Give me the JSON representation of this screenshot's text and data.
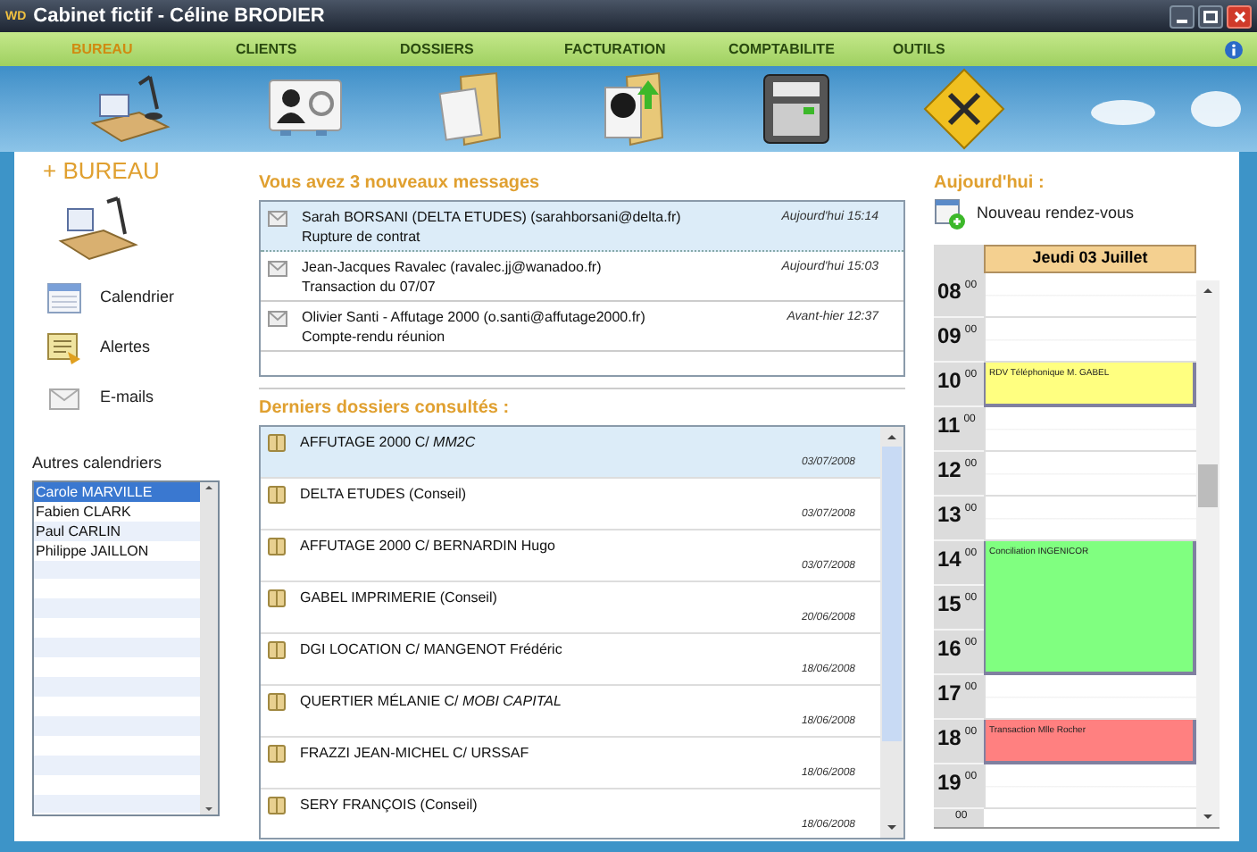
{
  "window": {
    "logo": "WD",
    "title": "Cabinet fictif - Céline BRODIER"
  },
  "menu": [
    {
      "label": "BUREAU",
      "selected": true
    },
    {
      "label": "CLIENTS",
      "selected": false
    },
    {
      "label": "DOSSIERS",
      "selected": false
    },
    {
      "label": "FACTURATION",
      "selected": false
    },
    {
      "label": "COMPTABILITE",
      "selected": false
    },
    {
      "label": "OUTILS",
      "selected": false
    }
  ],
  "sidebar": {
    "title": "+ BUREAU",
    "items": [
      {
        "label": "Calendrier"
      },
      {
        "label": "Alertes"
      },
      {
        "label": "E-mails"
      }
    ],
    "calendars_label": "Autres calendriers",
    "calendars": [
      {
        "name": "Carole MARVILLE",
        "selected": true
      },
      {
        "name": "Fabien CLARK",
        "selected": false
      },
      {
        "name": "Paul CARLIN",
        "selected": false
      },
      {
        "name": "Philippe JAILLON",
        "selected": false
      }
    ]
  },
  "messages": {
    "title": "Vous avez 3 nouveaux messages",
    "items": [
      {
        "sender": "Sarah BORSANI (DELTA ETUDES) (sarahborsani@delta.fr)",
        "subject": "Rupture de contrat",
        "time": "Aujourd'hui 15:14",
        "selected": true
      },
      {
        "sender": "Jean-Jacques Ravalec (ravalec.jj@wanadoo.fr)",
        "subject": "Transaction du 07/07",
        "time": "Aujourd'hui 15:03",
        "selected": false
      },
      {
        "sender": "Olivier Santi - Affutage 2000 (o.santi@affutage2000.fr)",
        "subject": "Compte-rendu réunion",
        "time": "Avant-hier 12:37",
        "selected": false
      }
    ]
  },
  "files": {
    "title": "Derniers dossiers consultés :",
    "items": [
      {
        "name": "AFFUTAGE 2000 C/ *MM2C*",
        "date": "03/07/2008",
        "selected": true
      },
      {
        "name": "DELTA ETUDES (Conseil)",
        "date": "03/07/2008",
        "selected": false
      },
      {
        "name": "AFFUTAGE 2000 C/ BERNARDIN Hugo",
        "date": "03/07/2008",
        "selected": false
      },
      {
        "name": "GABEL IMPRIMERIE (Conseil)",
        "date": "20/06/2008",
        "selected": false
      },
      {
        "name": "DGI LOCATION C/ MANGENOT Frédéric",
        "date": "18/06/2008",
        "selected": false
      },
      {
        "name": "QUERTIER MÉLANIE C/ *MOBI CAPITAL*",
        "date": "18/06/2008",
        "selected": false
      },
      {
        "name": "FRAZZI JEAN-MICHEL C/ URSSAF",
        "date": "18/06/2008",
        "selected": false
      },
      {
        "name": "SERY FRANÇOIS (Conseil)",
        "date": "18/06/2008",
        "selected": false
      }
    ]
  },
  "today": {
    "title": "Aujourd'hui :",
    "new_appointment": "Nouveau rendez-vous",
    "day": "Jeudi 03 Juillet",
    "hours": [
      {
        "hour": "08",
        "minutes": "00"
      },
      {
        "hour": "09",
        "minutes": "00"
      },
      {
        "hour": "10",
        "minutes": "00",
        "event": {
          "label": "RDV Téléphonique M. GABEL",
          "color": "#ffff80"
        }
      },
      {
        "hour": "11",
        "minutes": "00"
      },
      {
        "hour": "12",
        "minutes": "00"
      },
      {
        "hour": "13",
        "minutes": "00"
      },
      {
        "hour": "14",
        "minutes": "00",
        "event": {
          "label": "Conciliation INGENICOR",
          "color": "#80ff80"
        }
      },
      {
        "hour": "15",
        "minutes": "00",
        "continues": true
      },
      {
        "hour": "16",
        "minutes": "00",
        "continues": true
      },
      {
        "hour": "17",
        "minutes": "00"
      },
      {
        "hour": "18",
        "minutes": "00",
        "event": {
          "label": "Transaction Mlle Rocher",
          "color": "#ff8080"
        }
      },
      {
        "hour": "19",
        "minutes": "00"
      }
    ],
    "next_minutes": "00"
  }
}
